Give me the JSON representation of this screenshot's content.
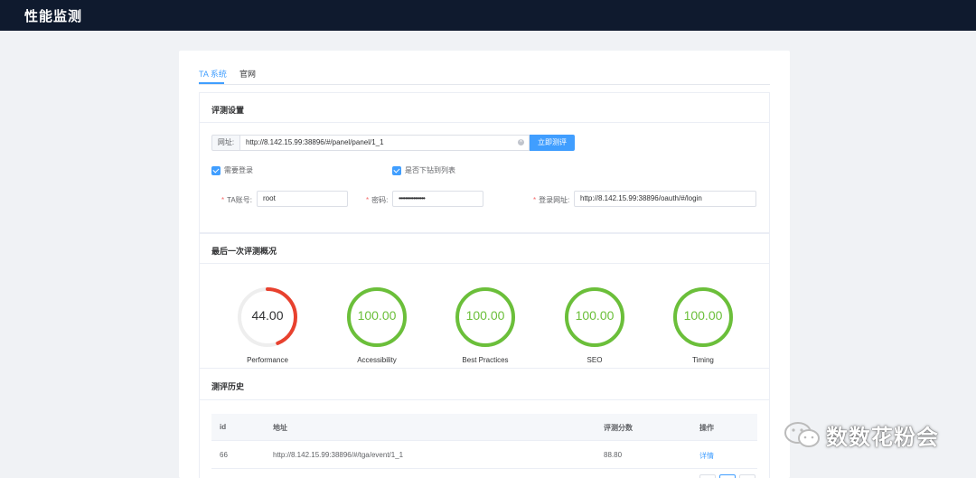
{
  "app": {
    "title": "性能监测"
  },
  "tabs": [
    {
      "label": "TA 系统",
      "active": true
    },
    {
      "label": "官网",
      "active": false
    }
  ],
  "settings": {
    "title": "评测设置",
    "url_prefix": "网址:",
    "url_value": "http://8.142.15.99:38896/#/panel/panel/1_1",
    "run_button": "立即测评",
    "need_login_label": "需要登录",
    "drilldown_label": "是否下钻到列表",
    "account_label": "TA账号:",
    "account_value": "root",
    "password_label": "密码:",
    "password_value": "••••••••••••••••",
    "login_url_label": "登录网址:",
    "login_url_value": "http://8.142.15.99:38896/oauth/#/login"
  },
  "summary": {
    "title": "最后一次评测概况",
    "gauges": [
      {
        "name": "Performance",
        "score": "44.00",
        "value": 44,
        "color": "#e8412e"
      },
      {
        "name": "Accessibility",
        "score": "100.00",
        "value": 100,
        "color": "#6bbf3a"
      },
      {
        "name": "Best Practices",
        "score": "100.00",
        "value": 100,
        "color": "#6bbf3a"
      },
      {
        "name": "SEO",
        "score": "100.00",
        "value": 100,
        "color": "#6bbf3a"
      },
      {
        "name": "Timing",
        "score": "100.00",
        "value": 100,
        "color": "#6bbf3a"
      }
    ]
  },
  "history": {
    "title": "测评历史",
    "columns": [
      "id",
      "地址",
      "评测分数",
      "操作"
    ],
    "rows": [
      {
        "id": "66",
        "address": "http://8.142.15.99:38896/#/tga/event/1_1",
        "score": "88.80",
        "action": "详情"
      }
    ]
  },
  "watermark": {
    "text": "数数花粉会"
  },
  "colors": {
    "primary": "#409eff",
    "header_bg": "#0f1a2e",
    "danger": "#e8412e",
    "success": "#6bbf3a"
  }
}
